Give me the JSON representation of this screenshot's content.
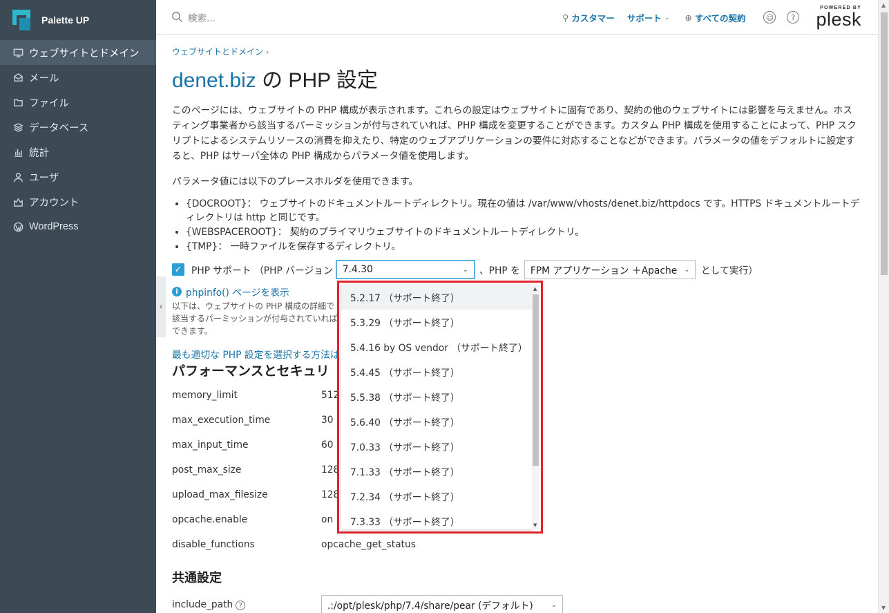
{
  "brand": {
    "name": "Palette UP"
  },
  "sidebar": {
    "items": [
      {
        "label": "ウェブサイトとドメイン",
        "icon": "monitor-icon",
        "active": true
      },
      {
        "label": "メール",
        "icon": "mail-icon"
      },
      {
        "label": "ファイル",
        "icon": "folder-icon"
      },
      {
        "label": "データベース",
        "icon": "database-icon"
      },
      {
        "label": "統計",
        "icon": "chart-icon"
      },
      {
        "label": "ユーザ",
        "icon": "user-icon"
      },
      {
        "label": "アカウント",
        "icon": "account-icon"
      },
      {
        "label": "WordPress",
        "icon": "wordpress-icon"
      }
    ]
  },
  "header": {
    "search_placeholder": "検索...",
    "customer": "カスタマー",
    "support": "サポート",
    "subscriptions": "すべての契約",
    "powered_by": "POWERED BY",
    "plesk": "plesk"
  },
  "main": {
    "breadcrumb": "ウェブサイトとドメイン",
    "title_domain": "denet.biz",
    "title_rest": " の PHP 設定",
    "description": "このページには、ウェブサイトの PHP 構成が表示されます。これらの設定はウェブサイトに固有であり、契約の他のウェブサイトには影響を与えません。ホスティング事業者から該当するパーミッションが付与されていれば、PHP 構成を変更することができます。カスタム PHP 構成を使用することによって、PHP スクリプトによるシステムリソースの消費を抑えたり、特定のウェブアプリケーションの要件に対応することなどができます。パラメータの値をデフォルトに設定すると、PHP はサーバ全体の PHP 構成からパラメータ値を使用します。",
    "placeholder_intro": "パラメータ値には以下のプレースホルダを使用できます。",
    "placeholders": [
      "{DOCROOT}： ウェブサイトのドキュメントルートディレクトリ。現在の値は /var/www/vhosts/denet.biz/httpdocs です。HTTPS ドキュメントルートディレクトリは http と同じです。",
      "{WEBSPACEROOT}： 契約のプライマリウェブサイトのドキュメントルートディレクトリ。",
      "{TMP}： 一時ファイルを保存するディレクトリ。"
    ],
    "php_support_label": "PHP サポート （PHP バージョン",
    "php_version": "7.4.30",
    "php_as": "、PHP を",
    "php_handler": "FPM アプリケーション ＋Apache",
    "php_run": "として実行）",
    "phpinfo_link": "phpinfo() ページを表示",
    "small_desc": "以下は、ウェブサイトの PHP 構成の詳細で該当するパーミッションが付与されていればできます。",
    "best_link": "最も適切な PHP 設定を選択する方法は",
    "perf_title": "パフォーマンスとセキュリ",
    "params": [
      {
        "key": "memory_limit",
        "value": "512"
      },
      {
        "key": "max_execution_time",
        "value": "30 ("
      },
      {
        "key": "max_input_time",
        "value": "60 ("
      },
      {
        "key": "post_max_size",
        "value": "128"
      },
      {
        "key": "upload_max_filesize",
        "value": "128"
      },
      {
        "key": "opcache.enable",
        "value": "on ("
      },
      {
        "key": "disable_functions",
        "value": "opcache_get_status"
      }
    ],
    "common_title": "共通設定",
    "include_path_label": "include_path",
    "include_path_value": ".:/opt/plesk/php/7.4/share/pear (デフォルト)"
  },
  "dropdown": {
    "options": [
      "5.2.17 （サポート終了）",
      "5.3.29 （サポート終了）",
      "5.4.16 by OS vendor （サポート終了）",
      "5.4.45 （サポート終了）",
      "5.5.38 （サポート終了）",
      "5.6.40 （サポート終了）",
      "7.0.33 （サポート終了）",
      "7.1.33 （サポート終了）",
      "7.2.34 （サポート終了）",
      "7.3.33 （サポート終了）"
    ]
  },
  "colors": {
    "sidebar": "#3c4a56",
    "accent": "#1a73a8",
    "highlight_border": "#e0222c"
  }
}
